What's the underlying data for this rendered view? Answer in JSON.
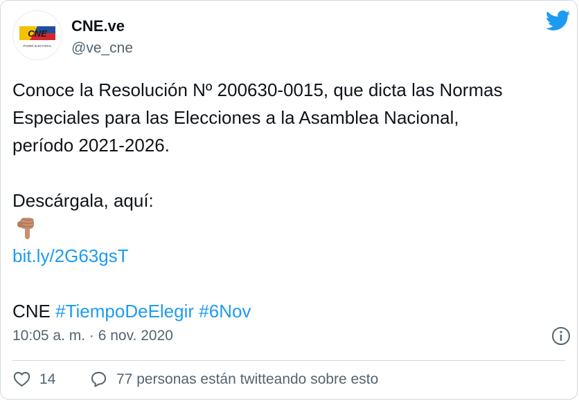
{
  "author": {
    "display_name": "CNE.ve",
    "handle": "@ve_cne",
    "avatar_logo_text": "CNE",
    "avatar_subtext": "PODER ELECTORAL"
  },
  "tweet": {
    "line1": "Conoce la Resolución Nº 200630-0015, que dicta las Normas",
    "line2": "Especiales para las Elecciones a la Asamblea Nacional,",
    "line3": "período 2021-2026.",
    "download_label": "Descárgala, aquí:",
    "emoji": "pointing-down-icon",
    "link": "bit.ly/2G63gsT",
    "signature": "CNE",
    "hashtags": [
      "#TiempoDeElegir",
      "#6Nov"
    ]
  },
  "timestamp": "10:05 a. m. · 6 nov. 2020",
  "actions": {
    "like_count": "14",
    "conversation_label": "77 personas están twitteando sobre esto"
  },
  "colors": {
    "link": "#1d9bf0",
    "text": "#0f1419",
    "secondary": "#536471",
    "border": "#cfd9de"
  }
}
